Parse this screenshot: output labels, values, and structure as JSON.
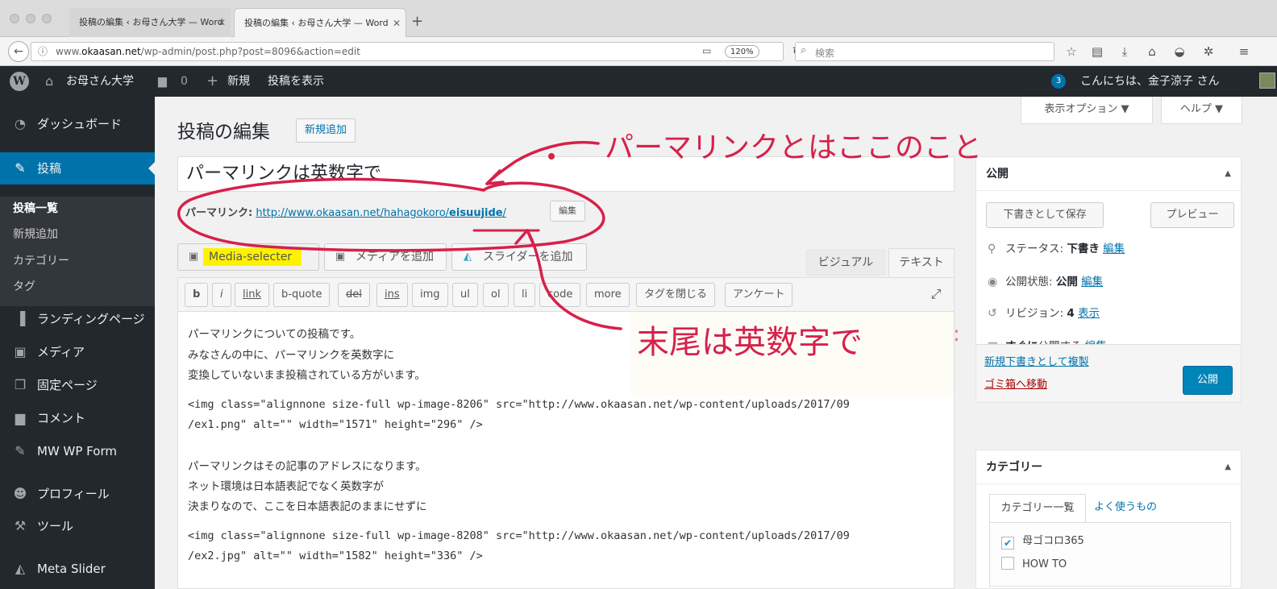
{
  "browser": {
    "tabs": [
      {
        "title": "投稿の編集 ‹ お母さん大学 — Word"
      },
      {
        "title": "投稿の編集 ‹ お母さん大学 — Word"
      }
    ],
    "url_prefix": "www.",
    "url_domain": "okaasan.net",
    "url_path": "/wp-admin/post.php?post=8096&action=edit",
    "zoom": "120%",
    "search_placeholder": "検索",
    "icons": [
      "back-icon",
      "info-icon",
      "reader-icon",
      "reload-icon",
      "search-icon",
      "star-icon",
      "reading-list-icon",
      "download-icon",
      "home-icon",
      "pocket-icon",
      "extension-icon",
      "menu-icon"
    ]
  },
  "adminbar": {
    "site_name": "お母さん大学",
    "comments_count": "0",
    "new_label": "新規",
    "view_post": "投稿を表示",
    "updates_count": "3",
    "greeting": "こんにちは、金子涼子 さん"
  },
  "sidebar": {
    "items": [
      {
        "label": "ダッシュボード",
        "icon": "dashboard-icon"
      },
      {
        "label": "投稿",
        "icon": "pin-icon"
      },
      {
        "label": "ランディングページ",
        "icon": "landing-icon"
      },
      {
        "label": "メディア",
        "icon": "media-icon"
      },
      {
        "label": "固定ページ",
        "icon": "pages-icon"
      },
      {
        "label": "コメント",
        "icon": "comment-icon"
      },
      {
        "label": "MW WP Form",
        "icon": "pin-icon"
      },
      {
        "label": "プロフィール",
        "icon": "user-icon"
      },
      {
        "label": "ツール",
        "icon": "wrench-icon"
      },
      {
        "label": "Meta Slider",
        "icon": "slider-icon"
      }
    ],
    "submenu": [
      "投稿一覧",
      "新規追加",
      "カテゴリー",
      "タグ"
    ]
  },
  "header": {
    "screen_options": "表示オプション ▼",
    "help": "ヘルプ ▼",
    "page_title": "投稿の編集",
    "add_new": "新規追加"
  },
  "editor": {
    "post_title": "パーマリンクは英数字で",
    "permalink_label": "パーマリンク:",
    "permalink_base": "http://www.okaasan.net/hahagokoro/",
    "permalink_slug": "eisuujide",
    "permalink_end": "/",
    "permalink_edit": "編集",
    "media_buttons": [
      "Media-selecter",
      "メディアを追加",
      "スライダーを追加"
    ],
    "tab_visual": "ビジュアル",
    "tab_text": "テキスト",
    "quicktags": [
      "b",
      "i",
      "link",
      "b-quote",
      "del",
      "ins",
      "img",
      "ul",
      "ol",
      "li",
      "code",
      "more",
      "タグを閉じる",
      "アンケート"
    ],
    "lines": [
      "パーマリンクについての投稿です。",
      "みなさんの中に、パーマリンクを英数字に",
      "変換していないまま投稿されている方がいます。",
      "",
      "<img class=\"alignnone size-full wp-image-8206\" src=\"http://www.okaasan.net/wp-content/uploads/2017/09",
      "/ex1.png\" alt=\"\" width=\"1571\" height=\"296\" />",
      "",
      "パーマリンクはその記事のアドレスになります。",
      "ネット環境は日本語表記でなく英数字が",
      "決まりなので、ここを日本語表記のままにせずに",
      "",
      "<img class=\"alignnone size-full wp-image-8208\" src=\"http://www.okaasan.net/wp-content/uploads/2017/09",
      "/ex2.jpg\" alt=\"\" width=\"1582\" height=\"336\" />"
    ]
  },
  "publish_box": {
    "title": "公開",
    "save_draft": "下書きとして保存",
    "preview": "プレビュー",
    "status_label": "ステータス:",
    "status_value": "下書き",
    "visibility_label": "公開状態:",
    "visibility_value": "公開",
    "revisions_label": "リビジョン:",
    "revisions_value": "4",
    "revisions_link": "表示",
    "schedule_bold": "すぐに",
    "schedule_rest": "公開する",
    "edit_link": "編集",
    "duplicate": "新規下書きとして複製",
    "trash": "ゴミ箱へ移動",
    "publish": "公開"
  },
  "category_box": {
    "title": "カテゴリー",
    "tab_all": "カテゴリー一覧",
    "tab_popular": "よく使うもの",
    "items": [
      {
        "label": "母ゴコロ365",
        "checked": true
      },
      {
        "label": "HOW TO",
        "checked": false
      }
    ]
  },
  "annotations": {
    "top": "パーマリンクとはここのこと",
    "bottom": "末尾は英数字で",
    "stray": ":",
    "color": "#d6214a"
  }
}
